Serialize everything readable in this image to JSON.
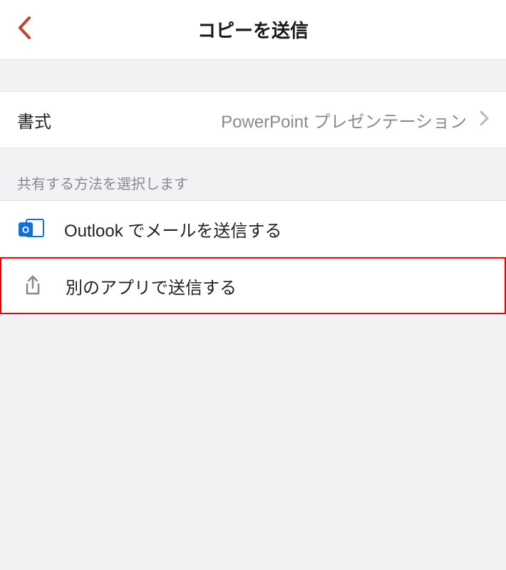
{
  "header": {
    "title": "コピーを送信"
  },
  "format": {
    "label": "書式",
    "value": "PowerPoint プレゼンテーション"
  },
  "section": {
    "caption": "共有する方法を選択します"
  },
  "actions": {
    "outlook": {
      "label": "Outlook でメールを送信する",
      "iconLetter": "O"
    },
    "otherApp": {
      "label": "別のアプリで送信する"
    }
  },
  "colors": {
    "accent": "#c1442e",
    "highlight": "#e60000",
    "outlook": "#1071d1"
  }
}
